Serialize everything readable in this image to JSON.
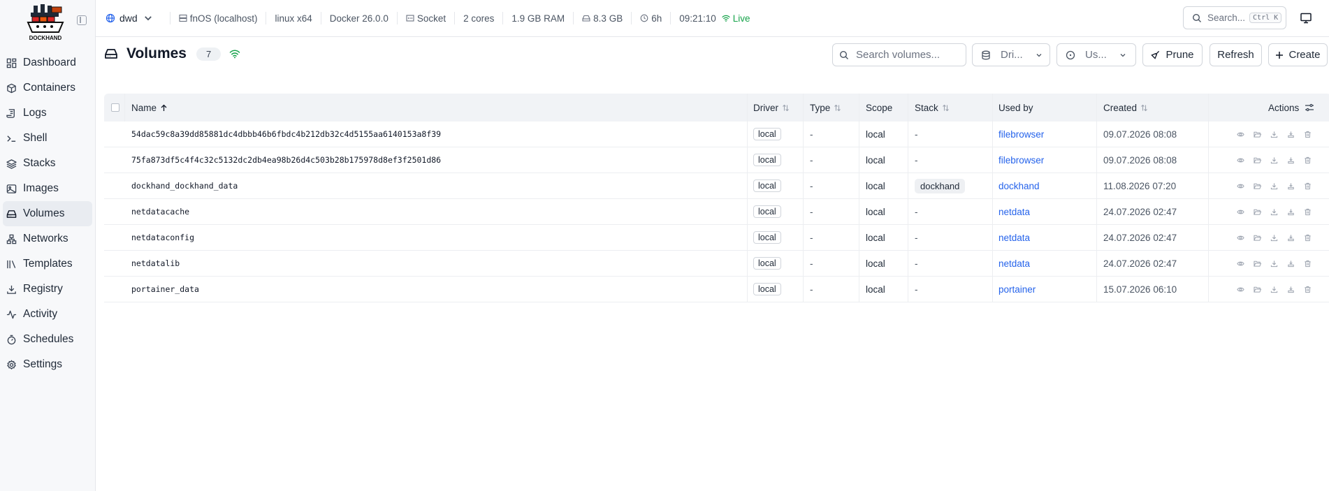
{
  "brand": {
    "name": "DOCKHAND"
  },
  "nav": [
    {
      "label": "Dashboard",
      "icon": "dashboard-icon"
    },
    {
      "label": "Containers",
      "icon": "cube-icon"
    },
    {
      "label": "Logs",
      "icon": "scroll-icon"
    },
    {
      "label": "Shell",
      "icon": "terminal-icon"
    },
    {
      "label": "Stacks",
      "icon": "layers-icon"
    },
    {
      "label": "Images",
      "icon": "image-icon"
    },
    {
      "label": "Volumes",
      "icon": "drive-icon",
      "active": true
    },
    {
      "label": "Networks",
      "icon": "network-icon"
    },
    {
      "label": "Templates",
      "icon": "library-icon"
    },
    {
      "label": "Registry",
      "icon": "download-icon"
    },
    {
      "label": "Activity",
      "icon": "activity-icon"
    },
    {
      "label": "Schedules",
      "icon": "timer-icon"
    },
    {
      "label": "Settings",
      "icon": "gear-icon"
    }
  ],
  "topbar": {
    "environment": "dwd",
    "host": "fnOS (localhost)",
    "platform": "linux x64",
    "docker": "Docker 26.0.0",
    "connection": "Socket",
    "cores": "2 cores",
    "ram": "1.9 GB RAM",
    "disk": "8.3 GB",
    "uptime": "6h",
    "time": "09:21:10",
    "live": "Live",
    "search_placeholder": "Search...",
    "shortcut": "Ctrl K"
  },
  "page": {
    "title": "Volumes",
    "count": "7",
    "search_placeholder": "Search volumes...",
    "driver_filter": "Dri...",
    "usage_filter": "Us...",
    "prune_label": "Prune",
    "refresh_label": "Refresh",
    "create_label": "Create"
  },
  "table": {
    "headers": {
      "name": "Name",
      "driver": "Driver",
      "type": "Type",
      "scope": "Scope",
      "stack": "Stack",
      "used_by": "Used by",
      "created": "Created",
      "actions": "Actions"
    },
    "rows": [
      {
        "name": "54dac59c8a39dd85881dc4dbbb46b6fbdc4b212db32c4d5155aa6140153a8f39",
        "driver": "local",
        "type": "-",
        "scope": "local",
        "stack": "-",
        "used_by": "filebrowser",
        "created": "09.07.2026 08:08"
      },
      {
        "name": "75fa873df5c4f4c32c5132dc2db4ea98b26d4c503b28b175978d8ef3f2501d86",
        "driver": "local",
        "type": "-",
        "scope": "local",
        "stack": "-",
        "used_by": "filebrowser",
        "created": "09.07.2026 08:08"
      },
      {
        "name": "dockhand_dockhand_data",
        "driver": "local",
        "type": "-",
        "scope": "local",
        "stack": "dockhand",
        "used_by": "dockhand",
        "created": "11.08.2026 07:20"
      },
      {
        "name": "netdatacache",
        "driver": "local",
        "type": "-",
        "scope": "local",
        "stack": "-",
        "used_by": "netdata",
        "created": "24.07.2026 02:47"
      },
      {
        "name": "netdataconfig",
        "driver": "local",
        "type": "-",
        "scope": "local",
        "stack": "-",
        "used_by": "netdata",
        "created": "24.07.2026 02:47"
      },
      {
        "name": "netdatalib",
        "driver": "local",
        "type": "-",
        "scope": "local",
        "stack": "-",
        "used_by": "netdata",
        "created": "24.07.2026 02:47"
      },
      {
        "name": "portainer_data",
        "driver": "local",
        "type": "-",
        "scope": "local",
        "stack": "-",
        "used_by": "portainer",
        "created": "15.07.2026 06:10"
      }
    ]
  },
  "colors": {
    "accent": "#2563eb",
    "live": "#16a34a",
    "sidebar_bg": "#f7f8fa",
    "header_bg": "#f1f3f6"
  }
}
